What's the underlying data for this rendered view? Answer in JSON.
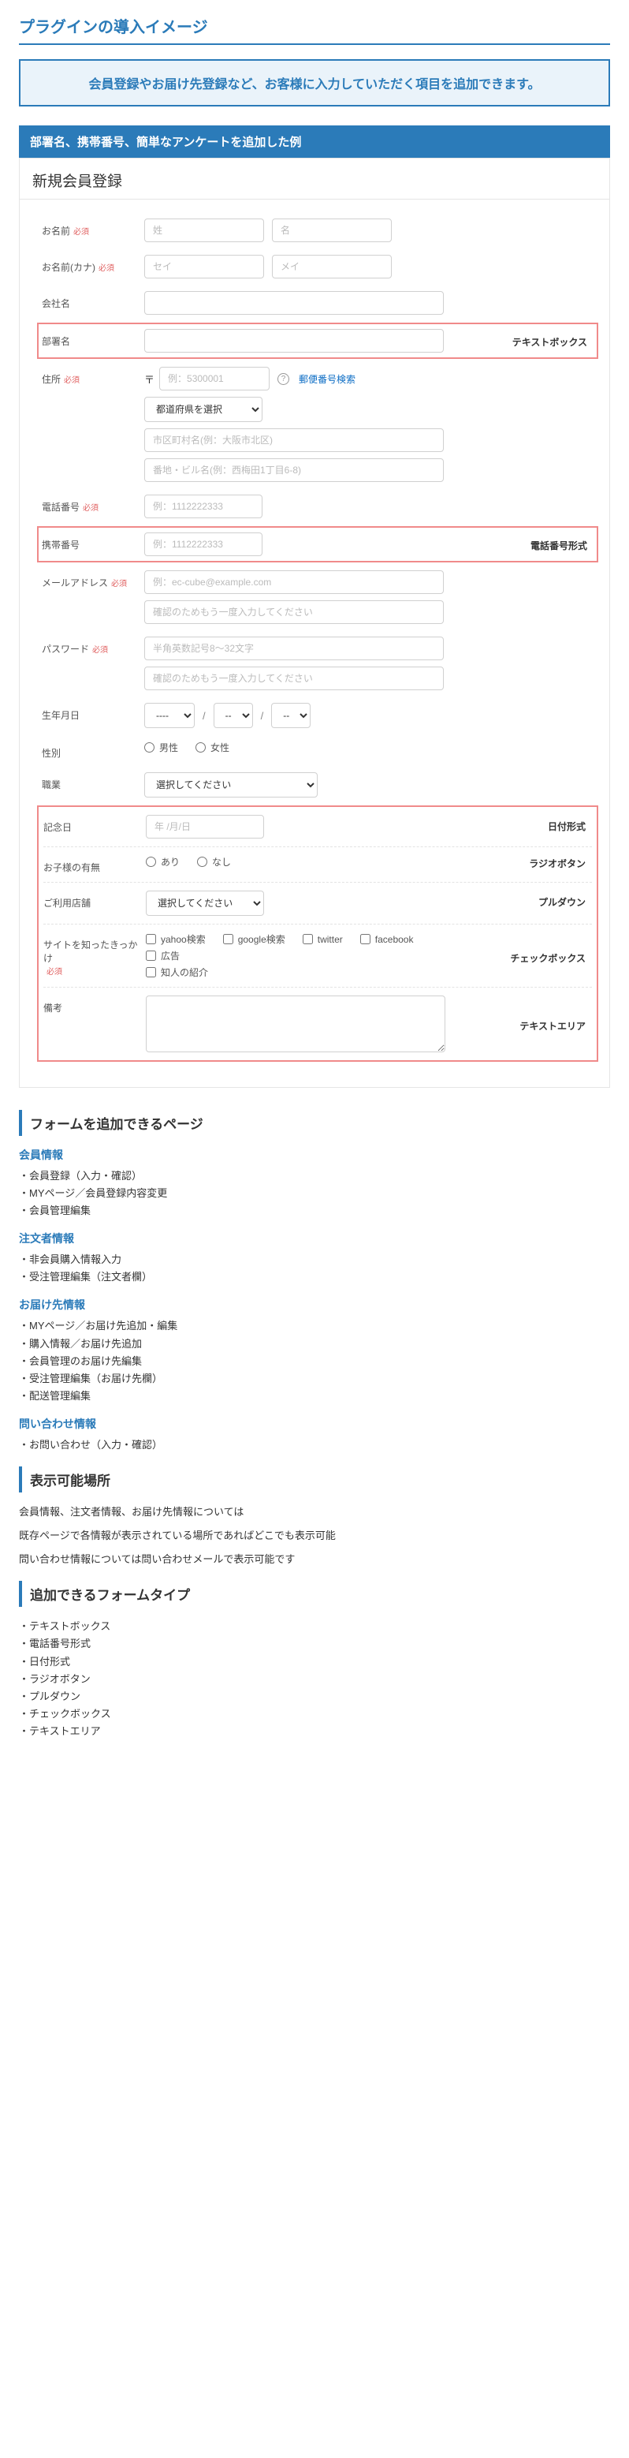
{
  "pageTitle": "プラグインの導入イメージ",
  "introBox": "会員登録やお届け先登録など、お客様に入力していただく項目を追加できます。",
  "barHeader": "部署名、携帯番号、簡単なアンケートを追加した例",
  "formTitle": "新規会員登録",
  "labels": {
    "name": "お名前",
    "kana": "お名前(カナ)",
    "company": "会社名",
    "busho": "部署名",
    "address": "住所",
    "tel": "電話番号",
    "mobile": "携帯番号",
    "email": "メールアドレス",
    "password": "パスワード",
    "birthday": "生年月日",
    "gender": "性別",
    "job": "職業",
    "anniversary": "記念日",
    "hasChild": "お子様の有無",
    "shop": "ご利用店舗",
    "survey": "サイトを知ったきっかけ",
    "memo": "備考",
    "required": "必須"
  },
  "placeholders": {
    "sei": "姓",
    "mei": "名",
    "seiKana": "セイ",
    "meiKana": "メイ",
    "zipPrefix": "〒",
    "zip": "例：5300001",
    "city": "市区町村名(例：大阪市北区)",
    "street": "番地・ビル名(例：西梅田1丁目6-8)",
    "tel": "例：1112222333",
    "mobile": "例：1112222333",
    "email": "例：ec-cube@example.com",
    "emailConfirm": "確認のためもう一度入力してください",
    "password": "半角英数記号8～32文字",
    "passwordConfirm": "確認のためもう一度入力してください",
    "date": "年 /月/日",
    "surveyOther": "知人の紹介"
  },
  "selects": {
    "pref": "都道府県を選択",
    "year": "----",
    "month": "--",
    "day": "--",
    "pleaseSelect": "選択してください"
  },
  "link": {
    "postal": "郵便番号検索"
  },
  "radios": {
    "male": "男性",
    "female": "女性",
    "ari": "あり",
    "nashi": "なし"
  },
  "checkboxes": {
    "yahoo": "yahoo検索",
    "google": "google検索",
    "twitter": "twitter",
    "facebook": "facebook",
    "ad": "広告"
  },
  "callouts": {
    "textbox": "テキストボックス",
    "telformat": "電話番号形式",
    "dateformat": "日付形式",
    "radiobtn": "ラジオボタン",
    "pulldown": "プルダウン",
    "checkbox": "チェックボックス",
    "textarea": "テキストエリア"
  },
  "sections": {
    "addPages": "フォームを追加できるページ",
    "memberInfo": "会員情報",
    "memberItems": [
      "会員登録（入力・確認）",
      "MYページ／会員登録内容変更",
      "会員管理編集"
    ],
    "orderInfo": "注文者情報",
    "orderItems": [
      "非会員購入情報入力",
      "受注管理編集（注文者欄）"
    ],
    "shipInfo": "お届け先情報",
    "shipItems": [
      "MYページ／お届け先追加・編集",
      "購入情報／お届け先追加",
      "会員管理のお届け先編集",
      "受注管理編集（お届け先欄）",
      "配送管理編集"
    ],
    "contactInfo": "問い合わせ情報",
    "contactItems": [
      "お問い合わせ（入力・確認）"
    ],
    "displayable": "表示可能場所",
    "displayText1": "会員情報、注文者情報、お届け先情報については",
    "displayText2": "既存ページで各情報が表示されている場所であればどこでも表示可能",
    "displayText3": "問い合わせ情報については問い合わせメールで表示可能です",
    "formTypes": "追加できるフォームタイプ",
    "formTypeItems": [
      "テキストボックス",
      "電話番号形式",
      "日付形式",
      "ラジオボタン",
      "プルダウン",
      "チェックボックス",
      "テキストエリア"
    ]
  }
}
